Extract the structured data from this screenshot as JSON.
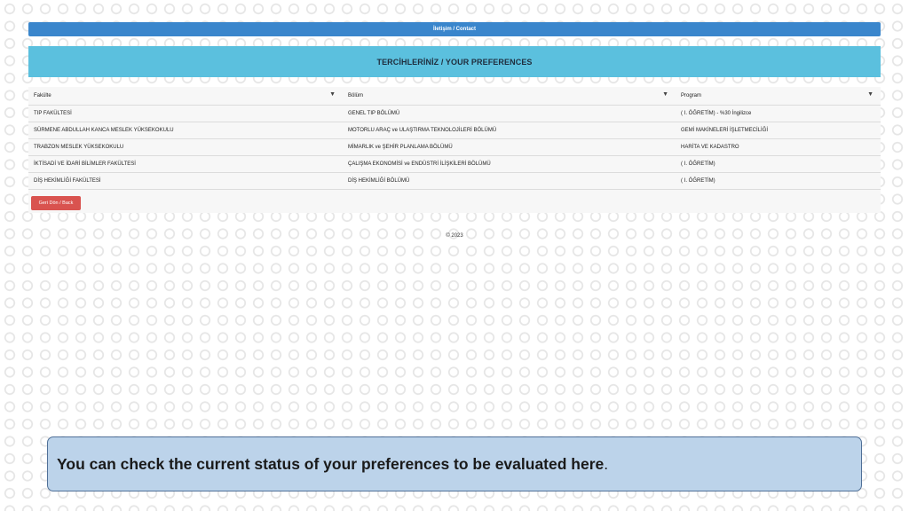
{
  "topbar": {
    "contact_label": "İletişim / Contact"
  },
  "header": {
    "title": "TERCİHLERİNİZ / YOUR PREFERENCES"
  },
  "table": {
    "columns": [
      "Fakülte",
      "Bölüm",
      "Program"
    ],
    "filter_icon": "filter-icon",
    "rows": [
      [
        "TIP FAKÜLTESİ",
        "GENEL TIP BÖLÜMÜ",
        "( I. ÖĞRETİM) - %30 İngilizce"
      ],
      [
        "SÜRMENE ABDULLAH KANCA MESLEK YÜKSEKOKULU",
        "MOTORLU ARAÇ ve ULAŞTIRMA TEKNOLOJİLERİ BÖLÜMÜ",
        "GEMİ MAKİNELERİ İŞLETMECİLİĞİ"
      ],
      [
        "TRABZON MESLEK YÜKSEKOKULU",
        "MİMARLIK ve ŞEHİR PLANLAMA BÖLÜMÜ",
        "HARİTA VE KADASTRO"
      ],
      [
        "İKTİSADİ VE İDARİ BİLİMLER FAKÜLTESİ",
        "ÇALIŞMA EKONOMİSİ ve ENDÜSTRİ İLİŞKİLERİ BÖLÜMÜ",
        "( I. ÖĞRETİM)"
      ],
      [
        "DİŞ HEKİMLİĞİ FAKÜLTESİ",
        "DİŞ HEKİMLİĞİ BÖLÜMÜ",
        "( I. ÖĞRETİM)"
      ]
    ]
  },
  "buttons": {
    "back_label": "Geri Dön / Back"
  },
  "footer": {
    "copyright": "© 2023"
  },
  "caption": {
    "text": "You can check the current status of your preferences to be evaluated here",
    "period": "."
  },
  "colors": {
    "topbar": "#3a86cc",
    "header": "#5bc0de",
    "back_button": "#d9534f",
    "caption_bg": "#bcd3ea"
  }
}
